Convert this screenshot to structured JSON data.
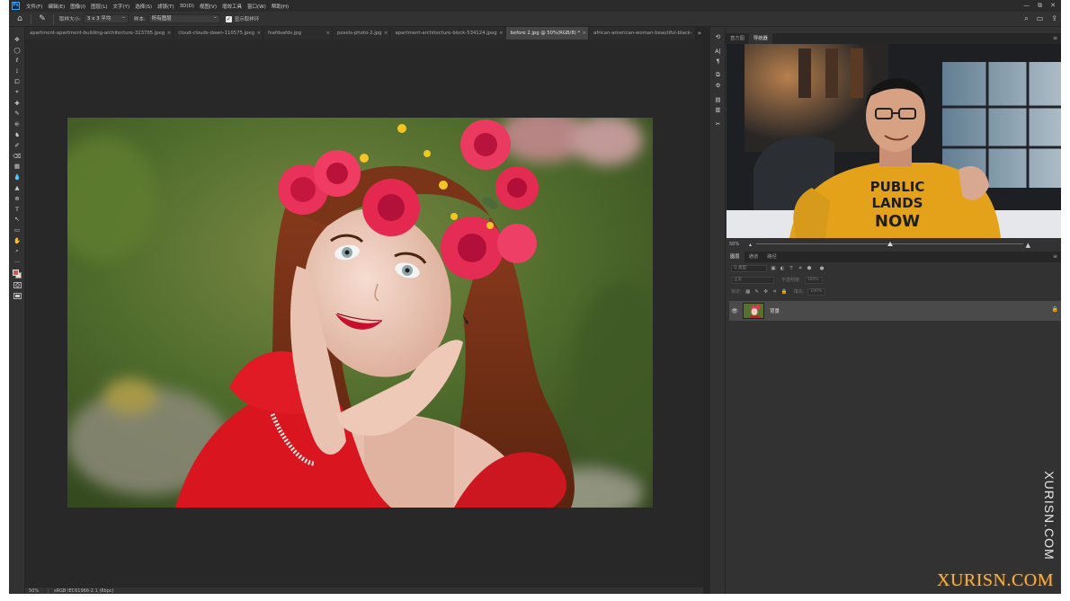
{
  "menubar": {
    "logo": "Ps",
    "items": [
      "文件(F)",
      "编辑(E)",
      "图像(I)",
      "图层(L)",
      "文字(Y)",
      "选择(S)",
      "滤镜(T)",
      "3D(D)",
      "视图(V)",
      "增效工具",
      "窗口(W)",
      "帮助(H)"
    ],
    "window_controls": [
      "—",
      "⧉",
      "✕"
    ]
  },
  "options": {
    "home_icon": "⌂",
    "tool_icon": "✎",
    "sample_size_label": "取样大小:",
    "sample_size_value": "3 x 3 平均",
    "sample_label": "样本:",
    "sample_value": "所有图层",
    "show_ring_label": "显示取样环",
    "show_ring_checked": "✓",
    "right_icons": [
      "⌕",
      "▭",
      "⇪"
    ]
  },
  "tools": [
    "✥",
    "◯",
    "ℓ",
    "⟟",
    "⧠",
    "⌖",
    "✚",
    "✎",
    "⎆",
    "♞",
    "✐",
    "⌫",
    "▦",
    "💧",
    "▲",
    "⊕",
    "T",
    "↖",
    "▭",
    "✋",
    "⌕",
    "···"
  ],
  "tabs": [
    {
      "label": "apartment-apartment-building-architecture-323705.jpeg",
      "close": "×"
    },
    {
      "label": "cloud-clouds-dawn-110575.jpeg",
      "close": "×"
    },
    {
      "label": "fsafdsafds.jpg",
      "close": "×"
    },
    {
      "label": "pexels-photo-2.jpg",
      "close": "×"
    },
    {
      "label": "apartment-architecture-block-534124.jpeg",
      "close": "×"
    },
    {
      "label": "before 2.jpg @ 50%(RGB/8) *",
      "close": "×"
    },
    {
      "label": "african-american-woman-beautiful-black-",
      "close": ""
    }
  ],
  "tab_overflow": "»",
  "status": {
    "zoom": "50%",
    "profile": "sRGB IEC61966-2.1 (8bpc)"
  },
  "panel_icons": [
    "⟲",
    "A|",
    "¶",
    "⧉",
    "⚙",
    "▤",
    "▥",
    "✂"
  ],
  "navigator": {
    "tabs": [
      "直方图",
      "导航器"
    ],
    "active_tab": 1,
    "menu_icon": "≡",
    "zoom": "50%",
    "slider_position": 0.5,
    "shirt_text": [
      "PUBLIC",
      "LANDS",
      "NOW"
    ]
  },
  "layers": {
    "tabs": [
      "图层",
      "通道",
      "路径"
    ],
    "active_tab": 0,
    "menu_icon": "≡",
    "filter_placeholder": "Q 类型",
    "filter_icons": [
      "▣",
      "◐",
      "T",
      "⌗",
      "⬟",
      "●"
    ],
    "blend_mode": "正常",
    "opacity_label": "不透明度:",
    "opacity_value": "100%",
    "lock_label": "锁定:",
    "lock_icons": [
      "▦",
      "✎",
      "✥",
      "⌗",
      "🔒"
    ],
    "fill_label": "填充:",
    "fill_value": "100%",
    "items": [
      {
        "name": "背景",
        "visible_icon": "👁",
        "locked_icon": "🔒"
      }
    ]
  },
  "watermark": {
    "vertical": "XURISN.COM",
    "logo": "XURISN.COM"
  }
}
